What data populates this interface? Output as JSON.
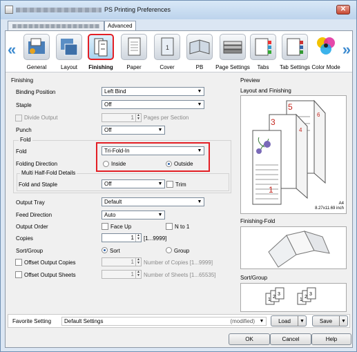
{
  "window": {
    "title": "PS Printing Preferences",
    "close_glyph": "✕"
  },
  "tabs": [
    {
      "label": ""
    },
    {
      "label": "Advanced"
    }
  ],
  "categories": [
    {
      "label": "General",
      "icon": "general-icon"
    },
    {
      "label": "Layout",
      "icon": "layout-icon"
    },
    {
      "label": "Finishing",
      "icon": "finishing-icon"
    },
    {
      "label": "Paper",
      "icon": "paper-icon"
    },
    {
      "label": "Cover",
      "icon": "cover-icon"
    },
    {
      "label": "PB",
      "icon": "perfect-binding-icon"
    },
    {
      "label": "Page Settings",
      "icon": "page-settings-icon"
    },
    {
      "label": "Tabs",
      "icon": "tabs-icon"
    },
    {
      "label": "Tab Settings",
      "icon": "tab-settings-icon"
    },
    {
      "label": "Color Mode",
      "icon": "color-mode-icon"
    }
  ],
  "finishing": {
    "section": "Finishing",
    "binding_position_label": "Binding Position",
    "binding_position_value": "Left Bind",
    "staple_label": "Staple",
    "staple_value": "Off",
    "divide_output_label": "Divide Output",
    "divide_output_value": "1",
    "pages_per_section": "Pages per Section",
    "punch_label": "Punch",
    "punch_value": "Off",
    "fold_group": "Fold",
    "fold_label": "Fold",
    "fold_value": "Tri-Fold-In",
    "folding_direction_label": "Folding Direction",
    "inside_label": "Inside",
    "outside_label": "Outside",
    "multi_half_fold_group": "Multi Half-Fold Details",
    "fold_and_staple_label": "Fold and Staple",
    "fold_and_staple_value": "Off",
    "trim_label": "Trim"
  },
  "output": {
    "output_tray_label": "Output Tray",
    "output_tray_value": "Default",
    "feed_direction_label": "Feed Direction",
    "feed_direction_value": "Auto",
    "output_order_label": "Output Order",
    "face_up_label": "Face Up",
    "n_to_1_label": "N to 1",
    "copies_label": "Copies",
    "copies_value": "1",
    "copies_range": "[1...9999]",
    "sort_group_label": "Sort/Group",
    "sort_label": "Sort",
    "group_label": "Group",
    "offset_output_copies_label": "Offset Output Copies",
    "offset_copies_value": "1",
    "offset_copies_hint": "Number of Copies [1...9999]",
    "offset_output_sheets_label": "Offset Output Sheets",
    "offset_sheets_value": "1",
    "offset_sheets_hint": "Number of Sheets [1...65535]"
  },
  "preview": {
    "section": "Preview",
    "layout_label": "Layout and Finishing",
    "page_numbers": [
      "1",
      "3",
      "4",
      "5",
      "6"
    ],
    "paper_size": "A4",
    "paper_dims": "8.27x11.69 inch",
    "finishing_fold_label": "Finishing-Fold",
    "sort_group_label": "Sort/Group"
  },
  "footer": {
    "favorite_label": "Favorite Setting",
    "favorite_value": "Default Settings",
    "modified_label": "(modified)",
    "load_label": "Load",
    "save_label": "Save",
    "ok_label": "OK",
    "cancel_label": "Cancel",
    "help_label": "Help"
  },
  "colors": {
    "highlight": "#e31e24",
    "accent": "#3d8bd0"
  }
}
